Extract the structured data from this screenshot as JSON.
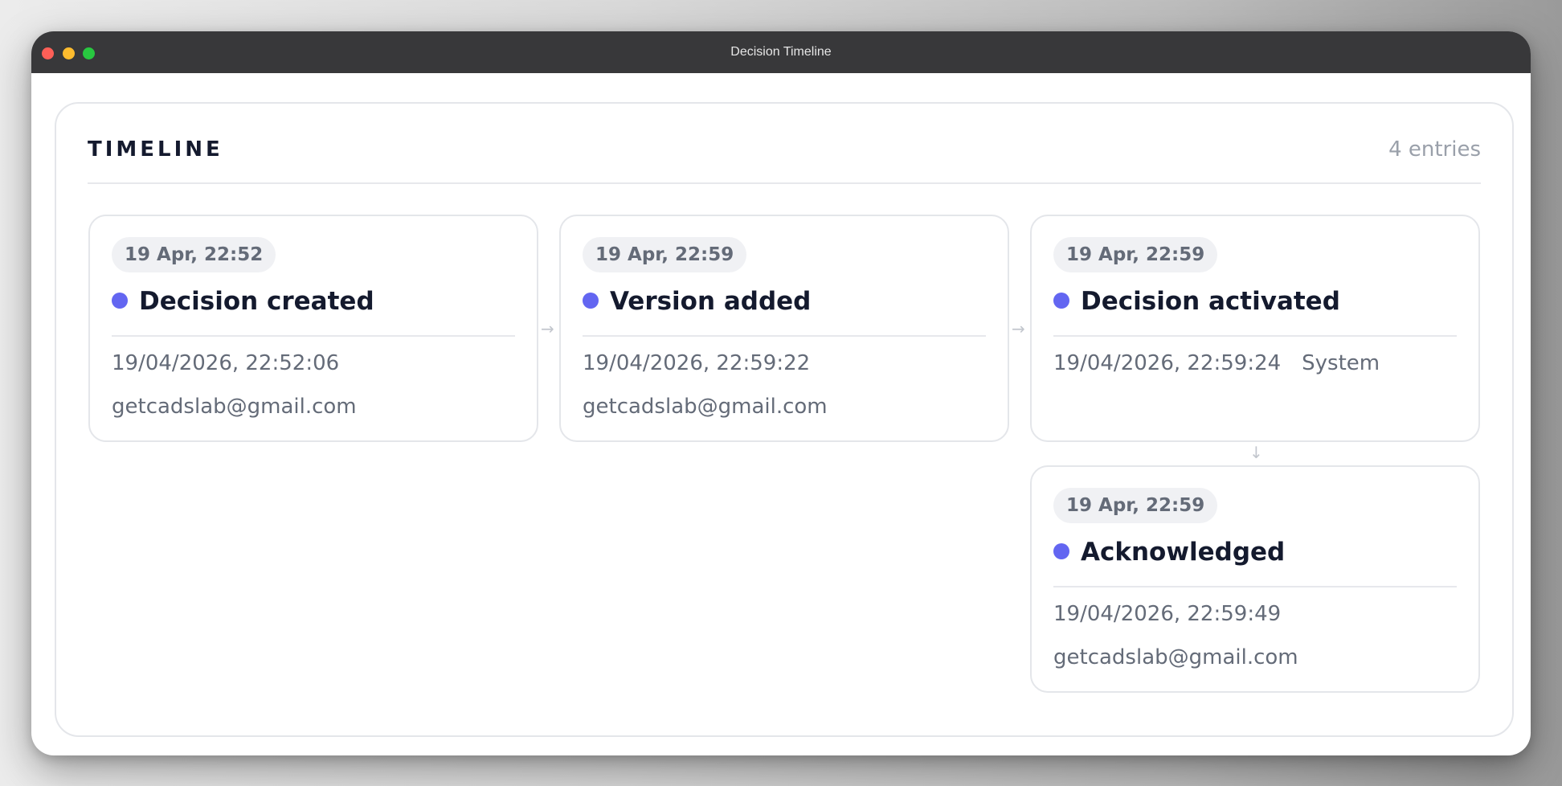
{
  "window": {
    "title": "Decision Timeline"
  },
  "timeline": {
    "title": "TIMELINE",
    "count_label": "4 entries",
    "entries": [
      {
        "time_label": "19 Apr, 22:52",
        "title": "Decision created",
        "datetime": "19/04/2026, 22:52:06",
        "actor": "",
        "email": "getcadslab@gmail.com"
      },
      {
        "time_label": "19 Apr, 22:59",
        "title": "Version added",
        "datetime": "19/04/2026, 22:59:22",
        "actor": "",
        "email": "getcadslab@gmail.com"
      },
      {
        "time_label": "19 Apr, 22:59",
        "title": "Decision activated",
        "datetime": "19/04/2026, 22:59:24",
        "actor": "System",
        "email": ""
      },
      {
        "time_label": "19 Apr, 22:59",
        "title": "Acknowledged",
        "datetime": "19/04/2026, 22:59:49",
        "actor": "",
        "email": "getcadslab@gmail.com"
      }
    ],
    "connectors": {
      "right": "→",
      "down": "↓"
    },
    "dot_color": "#6366f1"
  },
  "traffic_lights": {
    "close": "#ff5f57",
    "minimize": "#febc2e",
    "zoom": "#28c840"
  }
}
